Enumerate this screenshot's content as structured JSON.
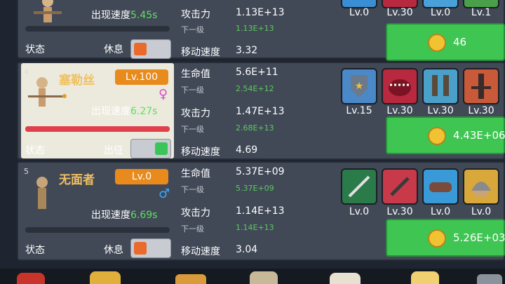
{
  "card_top": {
    "speed_label": "出现速度",
    "speed_value": "5.45s",
    "attack_label": "攻击力",
    "attack_value": "1.13E+13",
    "attack_next_label": "下一级",
    "attack_next_value": "1.13E+13",
    "move_label": "移动速度",
    "move_value": "3.32",
    "state_label": "状态",
    "state_value": "休息",
    "skill_levels": [
      "Lv.0",
      "Lv.30",
      "Lv.0",
      "Lv.1"
    ],
    "cost": "46"
  },
  "card_mid": {
    "index": "4",
    "name": "塞勒丝",
    "level": "Lv.100",
    "gender": "♀",
    "speed_label": "出现速度",
    "speed_value": "6.27s",
    "hp_fraction": 1.0,
    "hp_label": "生命值",
    "hp_value": "5.6E+11",
    "hp_next_label": "下一级",
    "hp_next_value": "2.54E+12",
    "attack_label": "攻击力",
    "attack_value": "1.47E+13",
    "attack_next_label": "下一级",
    "attack_next_value": "2.68E+13",
    "move_label": "移动速度",
    "move_value": "4.69",
    "state_label": "状态",
    "state_value": "出征",
    "skill_levels": [
      "Lv.15",
      "Lv.30",
      "Lv.30",
      "Lv.30"
    ],
    "cost": "4.43E+06"
  },
  "card_bottom": {
    "index": "5",
    "name": "无面者",
    "level": "Lv.0",
    "gender": "♂",
    "speed_label": "出现速度",
    "speed_value": "6.69s",
    "hp_label": "生命值",
    "hp_value": "5.37E+09",
    "hp_next_label": "下一级",
    "hp_next_value": "5.37E+09",
    "attack_label": "攻击力",
    "attack_value": "1.14E+13",
    "attack_next_label": "下一级",
    "attack_next_value": "1.14E+13",
    "move_label": "移动速度",
    "move_value": "3.04",
    "state_label": "状态",
    "state_value": "休息",
    "skill_levels": [
      "Lv.0",
      "Lv.30",
      "Lv.0",
      "Lv.0"
    ],
    "cost": "5.26E+03"
  },
  "colors": {
    "accent_orange": "#e88a1c",
    "value_green": "#5ec95e",
    "button_green": "#3ec552",
    "female_pink": "#e046c8",
    "male_blue": "#3aa8ff",
    "hp_red": "#e0404a"
  },
  "icons": {
    "skills_mid": [
      "shield-star-icon",
      "beast-mouth-icon",
      "armored-legs-icon",
      "dark-figure-icon"
    ],
    "skills_bottom": [
      "green-blade-icon",
      "red-sword-icon",
      "blue-glove-icon",
      "helmet-icon"
    ]
  }
}
